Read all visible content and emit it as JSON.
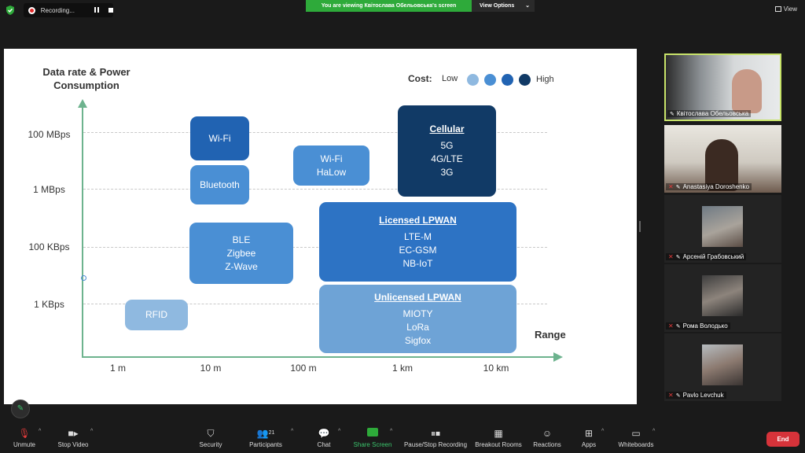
{
  "topbar": {
    "recording_label": "Recording...",
    "viewing_banner": "You are viewing Квітослава Обельовська's screen",
    "view_options_label": "View Options",
    "view_label": "View"
  },
  "slide": {
    "y_axis_title": "Data rate & Power Consumption",
    "x_axis_title": "Range",
    "y_ticks": [
      "100 MBps",
      "1 MBps",
      "100 KBps",
      "1 KBps"
    ],
    "x_ticks": [
      "1 m",
      "10 m",
      "100 m",
      "1 km",
      "10 km"
    ],
    "cost_legend": {
      "title": "Cost:",
      "low": "Low",
      "high": "High",
      "colors": [
        "#8fb9e0",
        "#4a8fd4",
        "#2163b2",
        "#113a66"
      ]
    },
    "boxes": [
      {
        "title": "",
        "lines": [
          "Wi-Fi"
        ],
        "color": "#2163b2"
      },
      {
        "title": "",
        "lines": [
          "Bluetooth"
        ],
        "color": "#4a8fd4"
      },
      {
        "title": "",
        "lines": [
          "Wi-Fi",
          "HaLow"
        ],
        "color": "#4a8fd4"
      },
      {
        "title": "Cellular",
        "lines": [
          "5G",
          "4G/LTE",
          "3G"
        ],
        "color": "#113a66"
      },
      {
        "title": "",
        "lines": [
          "BLE",
          "Zigbee",
          "Z-Wave"
        ],
        "color": "#4a8fd4"
      },
      {
        "title": "Licensed LPWAN",
        "lines": [
          "LTE-M",
          "EC-GSM",
          "NB-IoT"
        ],
        "color": "#2d73c4"
      },
      {
        "title": "",
        "lines": [
          "RFID"
        ],
        "color": "#8fb9e0"
      },
      {
        "title": "Unlicensed LPWAN",
        "lines": [
          "MIOTY",
          "LoRa",
          "Sigfox"
        ],
        "color": "#6ea3d6"
      }
    ]
  },
  "participants": [
    {
      "name": "Квітослава Обельовська",
      "muted": false,
      "active": true
    },
    {
      "name": "Anastasiya Doroshenko",
      "muted": true,
      "active": false
    },
    {
      "name": "Арсеній Грабовський",
      "muted": true,
      "active": false
    },
    {
      "name": "Рома Володько",
      "muted": true,
      "active": false
    },
    {
      "name": "Pavlo Levchuk",
      "muted": true,
      "active": false
    }
  ],
  "toolbar": {
    "unmute": "Unmute",
    "stop_video": "Stop Video",
    "security": "Security",
    "participants": "Participants",
    "participants_count": "21",
    "chat": "Chat",
    "share_screen": "Share Screen",
    "pause_recording": "Pause/Stop Recording",
    "breakout_rooms": "Breakout Rooms",
    "reactions": "Reactions",
    "apps": "Apps",
    "whiteboards": "Whiteboards",
    "end": "End"
  },
  "icons": {
    "security": "shield-icon",
    "mic": "microphone-muted-icon",
    "video": "video-camera-icon",
    "participants": "people-icon",
    "chat": "chat-bubble-icon",
    "share": "share-screen-icon",
    "recording": "pause-stop-icon",
    "breakout": "grid-icon",
    "reactions": "smiley-icon",
    "apps": "apps-icon",
    "whiteboards": "whiteboard-icon",
    "pencil": "pencil-icon"
  }
}
